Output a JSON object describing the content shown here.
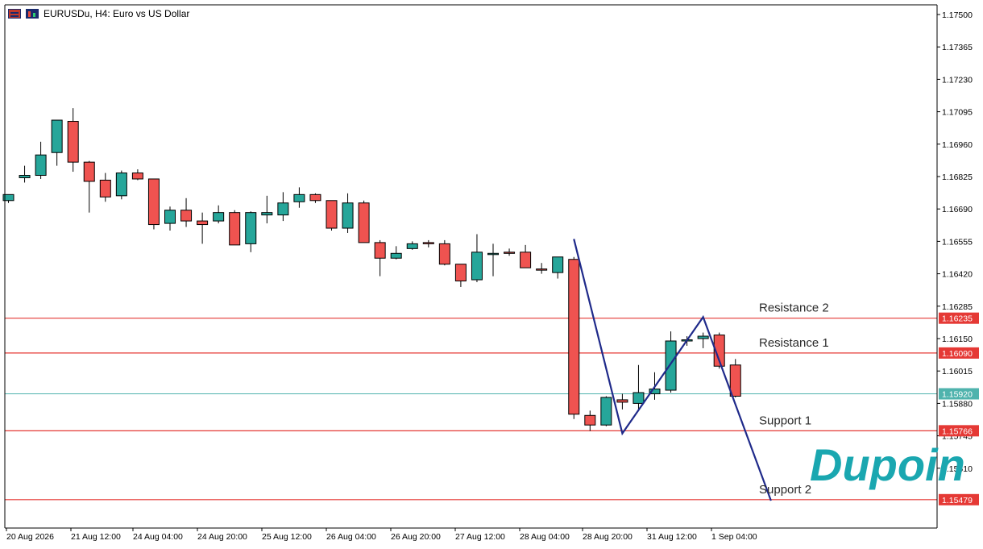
{
  "header": {
    "symbol_text": "EURUSDu, H4:  Euro vs US Dollar"
  },
  "colors": {
    "bull": "#26a69a",
    "bear": "#ef5350",
    "level_line": "#e53935",
    "current_line": "#4fb3ad",
    "zigzag": "#1f2a8a",
    "brand": "#1aa7b0"
  },
  "brand": {
    "logo_text": "Dupoin"
  },
  "chart_data": {
    "type": "candlestick",
    "title": "EURUSDu, H4:  Euro vs US Dollar",
    "ylim": [
      1.1535,
      1.1755
    ],
    "y_ticks": [
      "1.17500",
      "1.17365",
      "1.17230",
      "1.17095",
      "1.16960",
      "1.16825",
      "1.16690",
      "1.16555",
      "1.16420",
      "1.16285",
      "1.16150",
      "1.16015",
      "1.15880",
      "1.15745",
      "1.15610"
    ],
    "x_labels": [
      "20 Aug 2026",
      "21 Aug 12:00",
      "24 Aug 04:00",
      "24 Aug 20:00",
      "25 Aug 12:00",
      "26 Aug 04:00",
      "26 Aug 20:00",
      "27 Aug 12:00",
      "28 Aug 04:00",
      "28 Aug 20:00",
      "31 Aug 12:00",
      "1 Sep 04:00"
    ],
    "candles": [
      {
        "o": 1.16725,
        "h": 1.1675,
        "l": 1.16715,
        "c": 1.1675
      },
      {
        "o": 1.1682,
        "h": 1.1687,
        "l": 1.168,
        "c": 1.1683
      },
      {
        "o": 1.1683,
        "h": 1.1697,
        "l": 1.16815,
        "c": 1.16915
      },
      {
        "o": 1.16925,
        "h": 1.17,
        "l": 1.1687,
        "c": 1.1706
      },
      {
        "o": 1.17055,
        "h": 1.1711,
        "l": 1.16845,
        "c": 1.16885
      },
      {
        "o": 1.16885,
        "h": 1.1689,
        "l": 1.16675,
        "c": 1.16805
      },
      {
        "o": 1.1681,
        "h": 1.1684,
        "l": 1.1672,
        "c": 1.1674
      },
      {
        "o": 1.16745,
        "h": 1.1685,
        "l": 1.1673,
        "c": 1.1684
      },
      {
        "o": 1.1684,
        "h": 1.16855,
        "l": 1.1681,
        "c": 1.16815
      },
      {
        "o": 1.16815,
        "h": 1.16815,
        "l": 1.16605,
        "c": 1.16625
      },
      {
        "o": 1.1663,
        "h": 1.167,
        "l": 1.166,
        "c": 1.16685
      },
      {
        "o": 1.16685,
        "h": 1.16735,
        "l": 1.16615,
        "c": 1.1664
      },
      {
        "o": 1.1664,
        "h": 1.16675,
        "l": 1.16545,
        "c": 1.16625
      },
      {
        "o": 1.1664,
        "h": 1.16705,
        "l": 1.1663,
        "c": 1.16675
      },
      {
        "o": 1.16675,
        "h": 1.16685,
        "l": 1.16545,
        "c": 1.1654
      },
      {
        "o": 1.16545,
        "h": 1.1668,
        "l": 1.1651,
        "c": 1.16675
      },
      {
        "o": 1.16665,
        "h": 1.16745,
        "l": 1.1663,
        "c": 1.16675
      },
      {
        "o": 1.16665,
        "h": 1.1676,
        "l": 1.1664,
        "c": 1.16715
      },
      {
        "o": 1.1672,
        "h": 1.1678,
        "l": 1.16695,
        "c": 1.1675
      },
      {
        "o": 1.1675,
        "h": 1.16755,
        "l": 1.16715,
        "c": 1.16725
      },
      {
        "o": 1.16725,
        "h": 1.16725,
        "l": 1.166,
        "c": 1.1661
      },
      {
        "o": 1.1661,
        "h": 1.16755,
        "l": 1.1659,
        "c": 1.16715
      },
      {
        "o": 1.16715,
        "h": 1.16725,
        "l": 1.1655,
        "c": 1.1655
      },
      {
        "o": 1.1655,
        "h": 1.1656,
        "l": 1.1641,
        "c": 1.16485
      },
      {
        "o": 1.16485,
        "h": 1.16535,
        "l": 1.1648,
        "c": 1.16505
      },
      {
        "o": 1.16525,
        "h": 1.16555,
        "l": 1.1652,
        "c": 1.16545
      },
      {
        "o": 1.1655,
        "h": 1.1656,
        "l": 1.1653,
        "c": 1.16545
      },
      {
        "o": 1.16545,
        "h": 1.1656,
        "l": 1.16455,
        "c": 1.1646
      },
      {
        "o": 1.1646,
        "h": 1.1646,
        "l": 1.16365,
        "c": 1.1639
      },
      {
        "o": 1.16395,
        "h": 1.16585,
        "l": 1.16385,
        "c": 1.1651
      },
      {
        "o": 1.165,
        "h": 1.16545,
        "l": 1.1641,
        "c": 1.16505
      },
      {
        "o": 1.1651,
        "h": 1.16525,
        "l": 1.16495,
        "c": 1.16505
      },
      {
        "o": 1.1651,
        "h": 1.1654,
        "l": 1.16445,
        "c": 1.16445
      },
      {
        "o": 1.1644,
        "h": 1.16465,
        "l": 1.1642,
        "c": 1.16435
      },
      {
        "o": 1.16425,
        "h": 1.1649,
        "l": 1.164,
        "c": 1.1649
      },
      {
        "o": 1.1648,
        "h": 1.1649,
        "l": 1.15815,
        "c": 1.15835
      },
      {
        "o": 1.1583,
        "h": 1.1585,
        "l": 1.15765,
        "c": 1.1579
      },
      {
        "o": 1.1579,
        "h": 1.1591,
        "l": 1.15785,
        "c": 1.15905
      },
      {
        "o": 1.15895,
        "h": 1.1592,
        "l": 1.15855,
        "c": 1.15885
      },
      {
        "o": 1.1588,
        "h": 1.1604,
        "l": 1.15855,
        "c": 1.15925
      },
      {
        "o": 1.1592,
        "h": 1.1601,
        "l": 1.15895,
        "c": 1.1594
      },
      {
        "o": 1.15935,
        "h": 1.1618,
        "l": 1.15925,
        "c": 1.1614
      },
      {
        "o": 1.16145,
        "h": 1.1616,
        "l": 1.1612,
        "c": 1.16145
      },
      {
        "o": 1.1615,
        "h": 1.16175,
        "l": 1.1611,
        "c": 1.1616
      },
      {
        "o": 1.16165,
        "h": 1.16175,
        "l": 1.16025,
        "c": 1.16035
      },
      {
        "o": 1.1604,
        "h": 1.16065,
        "l": 1.15905,
        "c": 1.1591
      }
    ],
    "levels": [
      {
        "label": "Resistance 2",
        "price": "1.16235"
      },
      {
        "label": "Resistance 1",
        "price": "1.16090"
      },
      {
        "label": "Support 1",
        "price": "1.15766"
      },
      {
        "label": "Support 2",
        "price": "1.15479"
      }
    ],
    "current_price": {
      "price": "1.15920"
    },
    "zigzag": [
      {
        "i": 35,
        "p": 1.16565
      },
      {
        "i": 38,
        "p": 1.15755
      },
      {
        "i": 43,
        "p": 1.1624
      },
      {
        "i": 47.2,
        "p": 1.15475
      }
    ]
  }
}
